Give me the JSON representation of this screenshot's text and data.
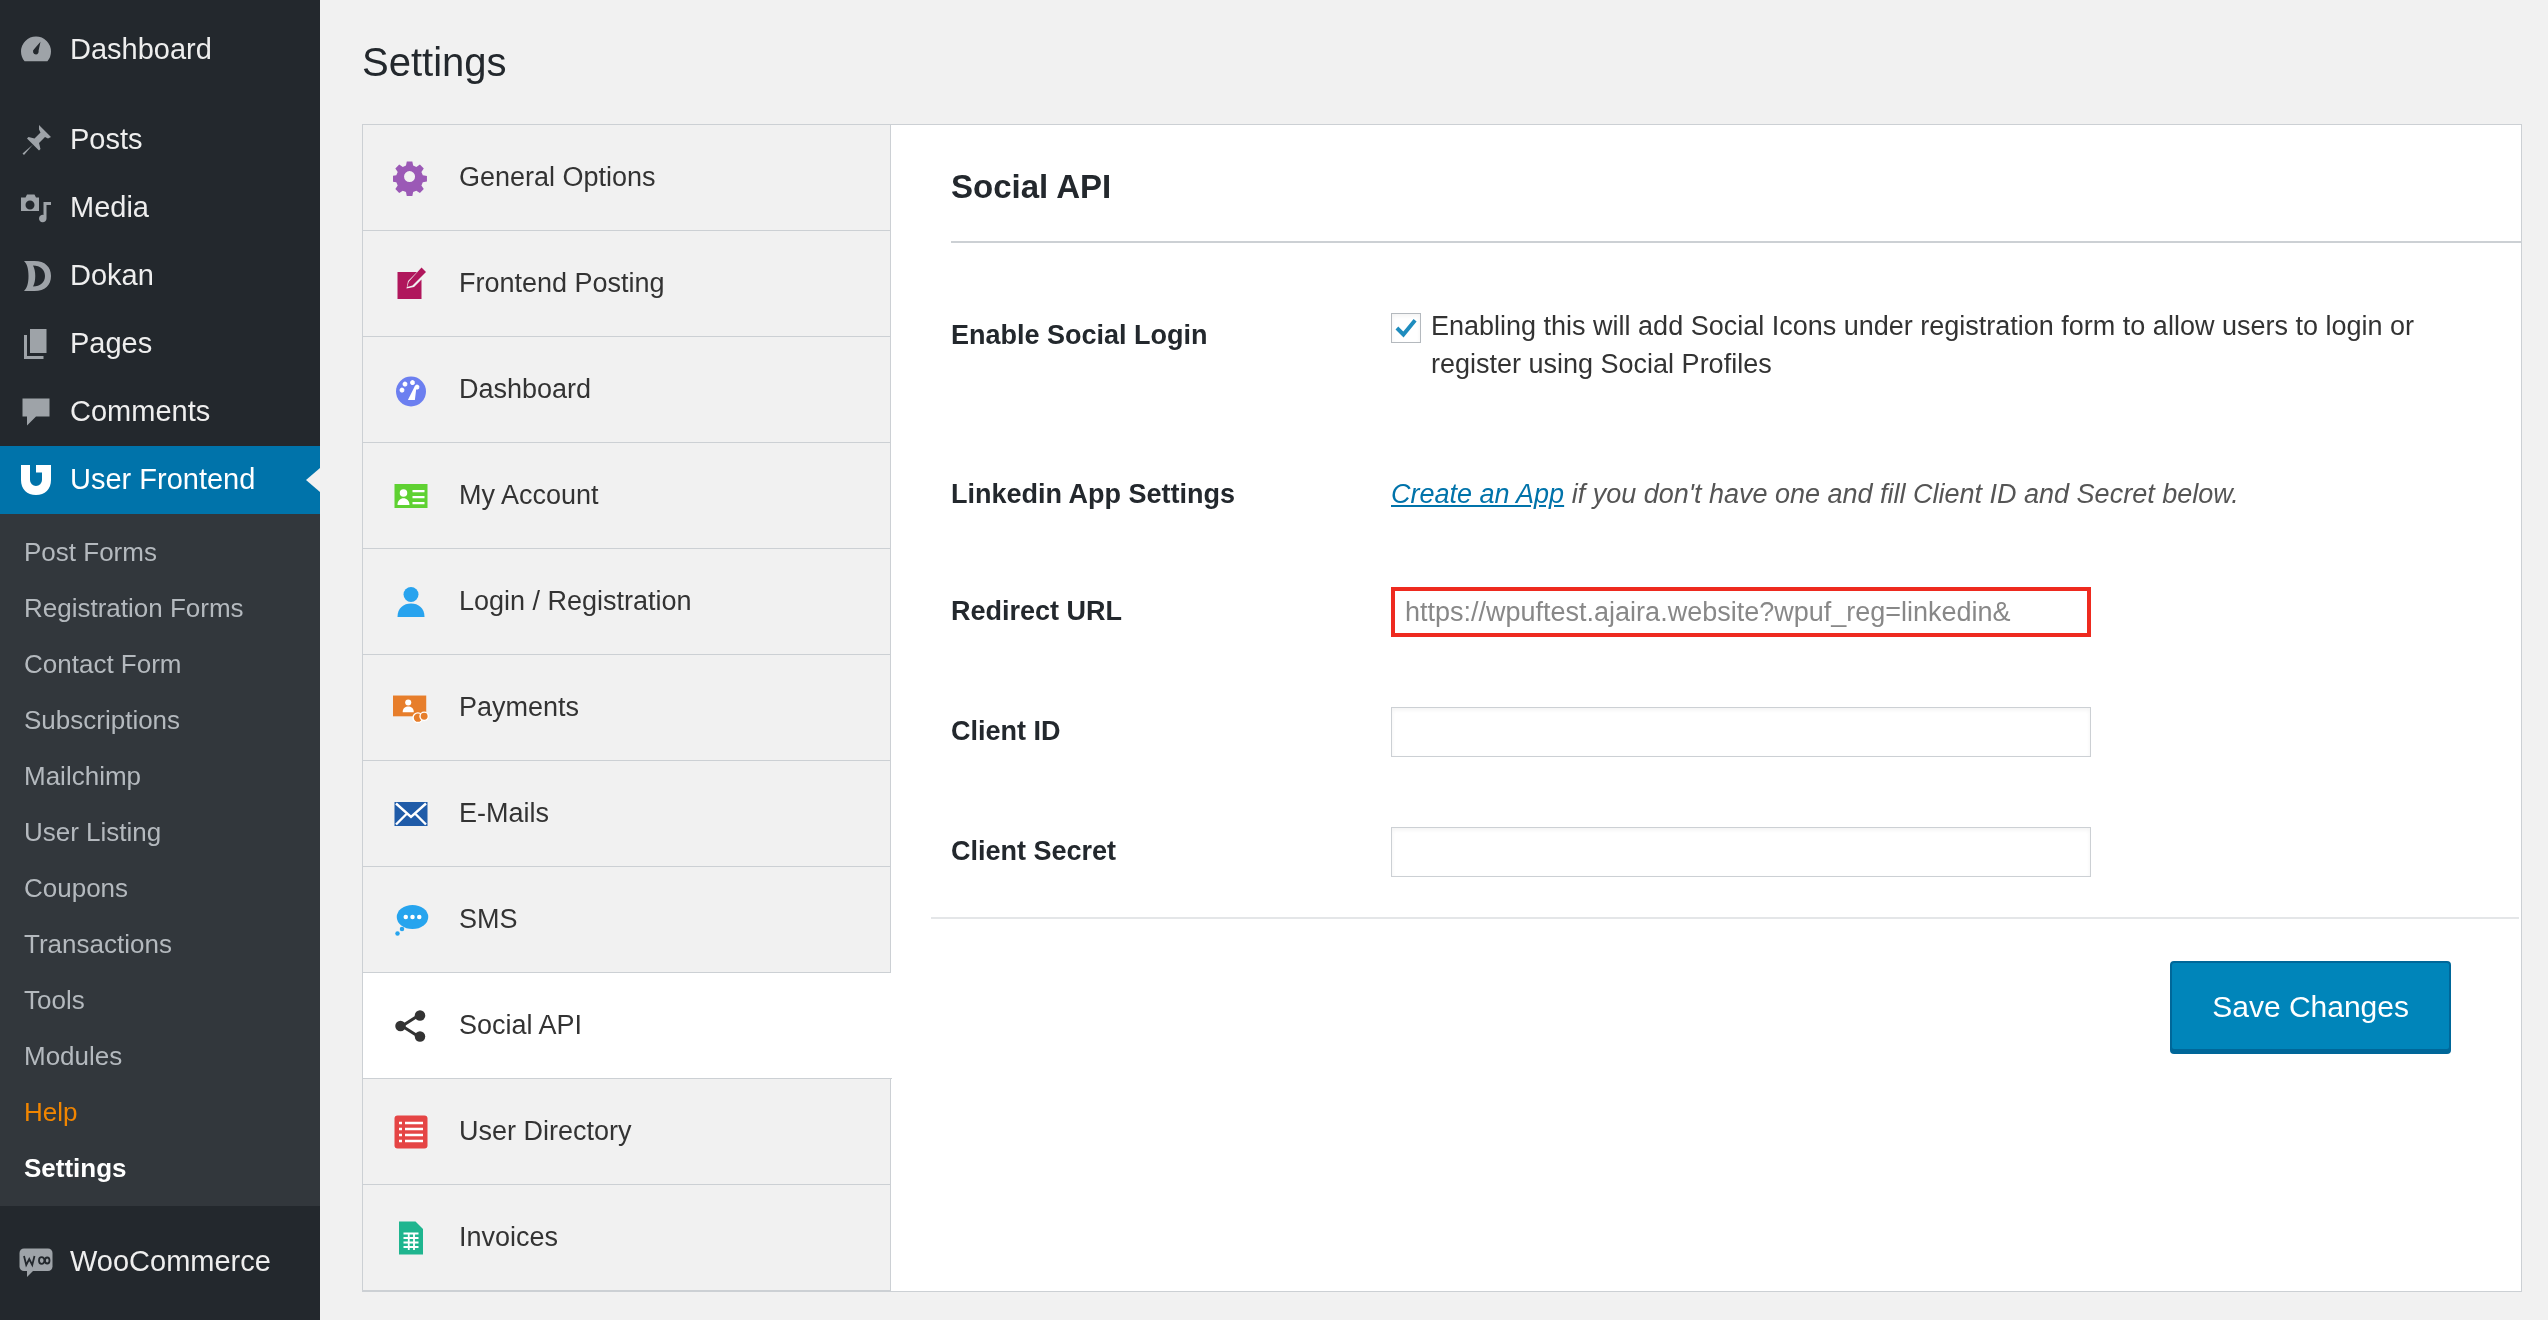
{
  "admin_menu": {
    "top": [
      {
        "label": "Dashboard",
        "kind": "gauge",
        "selected": false
      },
      {
        "label": "Posts",
        "kind": "pin",
        "selected": false
      },
      {
        "label": "Media",
        "kind": "media",
        "selected": false
      },
      {
        "label": "Dokan",
        "kind": "dokan",
        "selected": false
      },
      {
        "label": "Pages",
        "kind": "pages",
        "selected": false
      },
      {
        "label": "Comments",
        "kind": "comment",
        "selected": false
      },
      {
        "label": "User Frontend",
        "kind": "uf",
        "selected": true
      }
    ],
    "submenu": [
      {
        "label": "Post Forms",
        "selected": false,
        "highlight": false
      },
      {
        "label": "Registration Forms",
        "selected": false,
        "highlight": false
      },
      {
        "label": "Contact Form",
        "selected": false,
        "highlight": false
      },
      {
        "label": "Subscriptions",
        "selected": false,
        "highlight": false
      },
      {
        "label": "Mailchimp",
        "selected": false,
        "highlight": false
      },
      {
        "label": "User Listing",
        "selected": false,
        "highlight": false
      },
      {
        "label": "Coupons",
        "selected": false,
        "highlight": false
      },
      {
        "label": "Transactions",
        "selected": false,
        "highlight": false
      },
      {
        "label": "Tools",
        "selected": false,
        "highlight": false
      },
      {
        "label": "Modules",
        "selected": false,
        "highlight": false
      },
      {
        "label": "Help",
        "selected": false,
        "highlight": true
      },
      {
        "label": "Settings",
        "selected": true,
        "highlight": false
      }
    ],
    "bottom": [
      {
        "label": "WooCommerce",
        "kind": "woo",
        "selected": false
      }
    ]
  },
  "page_title": "Settings",
  "tabs": [
    {
      "label": "General Options",
      "kind": "gear",
      "selected": false
    },
    {
      "label": "Frontend Posting",
      "kind": "edit",
      "selected": false
    },
    {
      "label": "Dashboard",
      "kind": "gauge",
      "selected": false
    },
    {
      "label": "My Account",
      "kind": "card",
      "selected": false
    },
    {
      "label": "Login / Registration",
      "kind": "user",
      "selected": false
    },
    {
      "label": "Payments",
      "kind": "payment",
      "selected": false
    },
    {
      "label": "E-Mails",
      "kind": "mail",
      "selected": false
    },
    {
      "label": "SMS",
      "kind": "chat",
      "selected": false
    },
    {
      "label": "Social API",
      "kind": "share",
      "selected": true
    },
    {
      "label": "User Directory",
      "kind": "list",
      "selected": false
    },
    {
      "label": "Invoices",
      "kind": "sheet",
      "selected": false
    }
  ],
  "section_title": "Social API",
  "fields": [
    {
      "kind": "checkbox",
      "label": "Enable Social Login",
      "checked": true,
      "description": "Enabling this will add Social Icons under registration form to allow users to login or register using Social Profiles"
    },
    {
      "kind": "note",
      "label": "Linkedin App Settings",
      "link": "Create an App",
      "description": "if you don't have one and fill Client ID and Secret below."
    },
    {
      "kind": "text",
      "label": "Redirect URL",
      "value": "https://wpuftest.ajaira.website?wpuf_reg=linkedin&",
      "highlighted": true
    },
    {
      "kind": "text",
      "label": "Client ID",
      "highlighted": false
    },
    {
      "kind": "text",
      "label": "Client Secret",
      "highlighted": false
    }
  ],
  "save_button": "Save Changes"
}
